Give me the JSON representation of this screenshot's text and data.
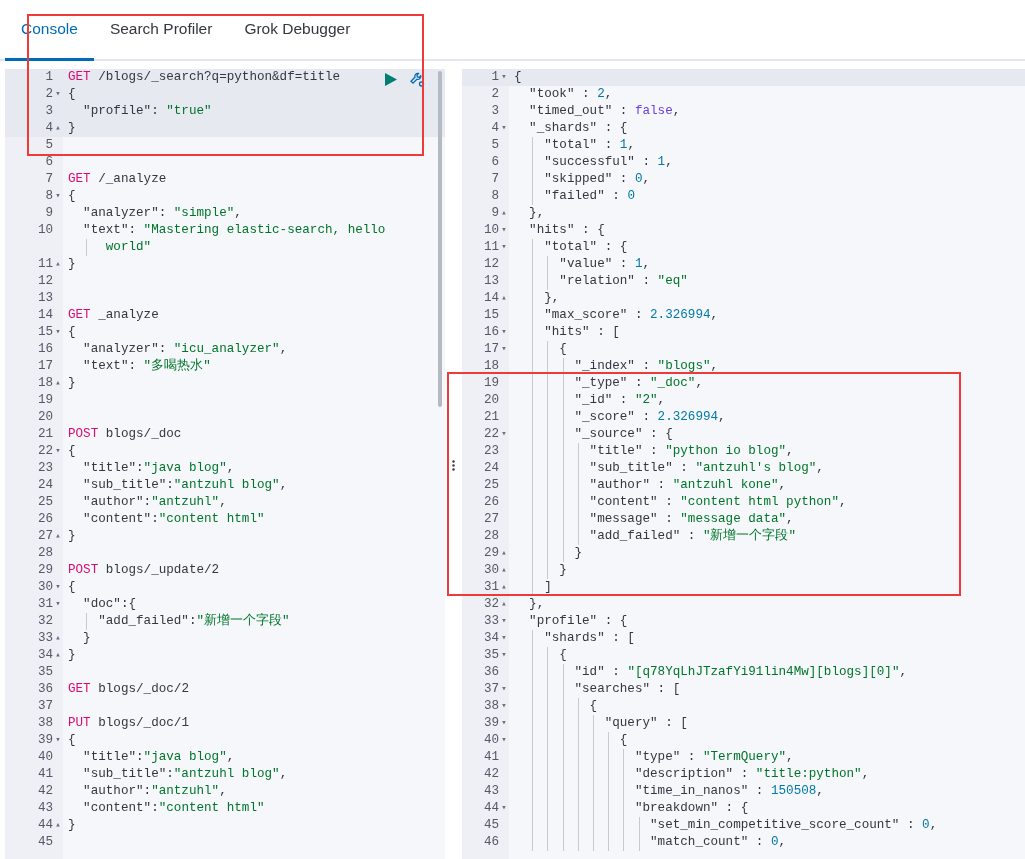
{
  "tabs": [
    {
      "label": "Console",
      "selected": true
    },
    {
      "label": "Search Profiler",
      "selected": false
    },
    {
      "label": "Grok Debugger",
      "selected": false
    }
  ],
  "request_editor": {
    "lines": [
      {
        "n": "1",
        "selected": true,
        "tokens": [
          {
            "kind": "method",
            "text": "GET"
          },
          {
            "kind": "plain",
            "text": " /blogs/_search?q=python&df=title"
          }
        ]
      },
      {
        "n": "2",
        "fold_toggle": "▾",
        "selected": true,
        "tokens": [
          {
            "kind": "plain",
            "text": "{"
          }
        ]
      },
      {
        "n": "3",
        "selected": true,
        "tokens": [
          {
            "kind": "plain",
            "text": "  \"profile\": "
          },
          {
            "kind": "string",
            "text": "\"true\""
          }
        ]
      },
      {
        "n": "4",
        "fold_toggle": "▴",
        "selected": true,
        "tokens": [
          {
            "kind": "plain",
            "text": "}"
          }
        ]
      },
      {
        "n": "5",
        "selected": false
      },
      {
        "n": "6",
        "selected": false
      },
      {
        "n": "7",
        "selected": false,
        "tokens": [
          {
            "kind": "method",
            "text": "GET"
          },
          {
            "kind": "plain",
            "text": " /_analyze"
          }
        ]
      },
      {
        "n": "8",
        "fold_toggle": "▾",
        "selected": false,
        "tokens": [
          {
            "kind": "plain",
            "text": "{"
          }
        ]
      },
      {
        "n": "9",
        "selected": false,
        "tokens": [
          {
            "kind": "plain",
            "text": "  \"analyzer\": "
          },
          {
            "kind": "string",
            "text": "\"simple\""
          },
          {
            "kind": "plain",
            "text": ","
          }
        ]
      },
      {
        "n": "10",
        "selected": false,
        "tokens": [
          {
            "kind": "plain",
            "text": "  \"text\": "
          },
          {
            "kind": "string",
            "text": "\"Mastering elastic-search, hello"
          }
        ]
      },
      {
        "selected": false,
        "tokens": [
          {
            "kind": "string",
            "text": "     world\""
          }
        ]
      },
      {
        "n": "11",
        "fold_toggle": "▴",
        "selected": false,
        "tokens": [
          {
            "kind": "plain",
            "text": "}"
          }
        ]
      },
      {
        "n": "12",
        "selected": false
      },
      {
        "n": "13",
        "selected": false
      },
      {
        "n": "14",
        "selected": false,
        "tokens": [
          {
            "kind": "method",
            "text": "GET"
          },
          {
            "kind": "plain",
            "text": " _analyze"
          }
        ]
      },
      {
        "n": "15",
        "fold_toggle": "▾",
        "selected": false,
        "tokens": [
          {
            "kind": "plain",
            "text": "{"
          }
        ]
      },
      {
        "n": "16",
        "selected": false,
        "tokens": [
          {
            "kind": "plain",
            "text": "  \"analyzer\": "
          },
          {
            "kind": "string",
            "text": "\"icu_analyzer\""
          },
          {
            "kind": "plain",
            "text": ","
          }
        ]
      },
      {
        "n": "17",
        "selected": false,
        "tokens": [
          {
            "kind": "plain",
            "text": "  \"text\": "
          },
          {
            "kind": "string",
            "text": "\"多喝热水\""
          }
        ]
      },
      {
        "n": "18",
        "fold_toggle": "▴",
        "selected": false,
        "tokens": [
          {
            "kind": "plain",
            "text": "}"
          }
        ]
      },
      {
        "n": "19",
        "selected": false
      },
      {
        "n": "20",
        "selected": false
      },
      {
        "n": "21",
        "selected": false,
        "tokens": [
          {
            "kind": "method",
            "text": "POST"
          },
          {
            "kind": "plain",
            "text": " blogs/_doc"
          }
        ]
      },
      {
        "n": "22",
        "fold_toggle": "▾",
        "selected": false,
        "tokens": [
          {
            "kind": "plain",
            "text": "{"
          }
        ]
      },
      {
        "n": "23",
        "selected": false,
        "tokens": [
          {
            "kind": "plain",
            "text": "  \"title\":"
          },
          {
            "kind": "string",
            "text": "\"java blog\""
          },
          {
            "kind": "plain",
            "text": ","
          }
        ]
      },
      {
        "n": "24",
        "selected": false,
        "tokens": [
          {
            "kind": "plain",
            "text": "  \"sub_title\":"
          },
          {
            "kind": "string",
            "text": "\"antzuhl blog\""
          },
          {
            "kind": "plain",
            "text": ","
          }
        ]
      },
      {
        "n": "25",
        "selected": false,
        "tokens": [
          {
            "kind": "plain",
            "text": "  \"author\":"
          },
          {
            "kind": "string",
            "text": "\"antzuhl\""
          },
          {
            "kind": "plain",
            "text": ","
          }
        ]
      },
      {
        "n": "26",
        "selected": false,
        "tokens": [
          {
            "kind": "plain",
            "text": "  \"content\":"
          },
          {
            "kind": "string",
            "text": "\"content html\""
          }
        ]
      },
      {
        "n": "27",
        "fold_toggle": "▴",
        "selected": false,
        "tokens": [
          {
            "kind": "plain",
            "text": "}"
          }
        ]
      },
      {
        "n": "28",
        "selected": false
      },
      {
        "n": "29",
        "selected": false,
        "tokens": [
          {
            "kind": "method",
            "text": "POST"
          },
          {
            "kind": "plain",
            "text": " blogs/_update/2"
          }
        ]
      },
      {
        "n": "30",
        "fold_toggle": "▾",
        "selected": false,
        "tokens": [
          {
            "kind": "plain",
            "text": "{"
          }
        ]
      },
      {
        "n": "31",
        "fold_toggle": "▾",
        "selected": false,
        "tokens": [
          {
            "kind": "plain",
            "text": "  \"doc\":{"
          }
        ]
      },
      {
        "n": "32",
        "selected": false,
        "tokens": [
          {
            "kind": "plain",
            "text": "    \"add_failed\":"
          },
          {
            "kind": "string",
            "text": "\"新增一个字段\""
          }
        ]
      },
      {
        "n": "33",
        "fold_toggle": "▴",
        "selected": false,
        "tokens": [
          {
            "kind": "plain",
            "text": "  }"
          }
        ]
      },
      {
        "n": "34",
        "fold_toggle": "▴",
        "selected": false,
        "tokens": [
          {
            "kind": "plain",
            "text": "}"
          }
        ]
      },
      {
        "n": "35",
        "selected": false
      },
      {
        "n": "36",
        "selected": false,
        "tokens": [
          {
            "kind": "method",
            "text": "GET"
          },
          {
            "kind": "plain",
            "text": " blogs/_doc/2"
          }
        ]
      },
      {
        "n": "37",
        "selected": false
      },
      {
        "n": "38",
        "selected": false,
        "tokens": [
          {
            "kind": "method",
            "text": "PUT"
          },
          {
            "kind": "plain",
            "text": " blogs/_doc/1"
          }
        ]
      },
      {
        "n": "39",
        "fold_toggle": "▾",
        "selected": false,
        "tokens": [
          {
            "kind": "plain",
            "text": "{"
          }
        ]
      },
      {
        "n": "40",
        "selected": false,
        "tokens": [
          {
            "kind": "plain",
            "text": "  \"title\":"
          },
          {
            "kind": "string",
            "text": "\"java blog\""
          },
          {
            "kind": "plain",
            "text": ","
          }
        ]
      },
      {
        "n": "41",
        "selected": false,
        "tokens": [
          {
            "kind": "plain",
            "text": "  \"sub_title\":"
          },
          {
            "kind": "string",
            "text": "\"antzuhl blog\""
          },
          {
            "kind": "plain",
            "text": ","
          }
        ]
      },
      {
        "n": "42",
        "selected": false,
        "tokens": [
          {
            "kind": "plain",
            "text": "  \"author\":"
          },
          {
            "kind": "string",
            "text": "\"antzuhl\""
          },
          {
            "kind": "plain",
            "text": ","
          }
        ]
      },
      {
        "n": "43",
        "selected": false,
        "tokens": [
          {
            "kind": "plain",
            "text": "  \"content\":"
          },
          {
            "kind": "string",
            "text": "\"content html\""
          }
        ]
      },
      {
        "n": "44",
        "fold_toggle": "▴",
        "selected": false,
        "tokens": [
          {
            "kind": "plain",
            "text": "}"
          }
        ]
      },
      {
        "n": "45",
        "selected": false
      }
    ]
  },
  "response_viewer": {
    "lines": [
      {
        "n": "1",
        "fold_toggle": "▾",
        "selected": true,
        "tokens": [
          {
            "kind": "plain",
            "text": "{"
          }
        ]
      },
      {
        "n": "2",
        "selected": false,
        "tokens": [
          {
            "kind": "plain",
            "text": "  \"took\" : "
          },
          {
            "kind": "number",
            "text": "2"
          },
          {
            "kind": "plain",
            "text": ","
          }
        ]
      },
      {
        "n": "3",
        "selected": false,
        "tokens": [
          {
            "kind": "plain",
            "text": "  \"timed_out\" : "
          },
          {
            "kind": "boolean",
            "text": "false"
          },
          {
            "kind": "plain",
            "text": ","
          }
        ]
      },
      {
        "n": "4",
        "fold_toggle": "▾",
        "selected": false,
        "tokens": [
          {
            "kind": "plain",
            "text": "  \"_shards\" : {"
          }
        ]
      },
      {
        "n": "5",
        "selected": false,
        "tokens": [
          {
            "kind": "plain",
            "text": "    \"total\" : "
          },
          {
            "kind": "number",
            "text": "1"
          },
          {
            "kind": "plain",
            "text": ","
          }
        ]
      },
      {
        "n": "6",
        "selected": false,
        "tokens": [
          {
            "kind": "plain",
            "text": "    \"successful\" : "
          },
          {
            "kind": "number",
            "text": "1"
          },
          {
            "kind": "plain",
            "text": ","
          }
        ]
      },
      {
        "n": "7",
        "selected": false,
        "tokens": [
          {
            "kind": "plain",
            "text": "    \"skipped\" : "
          },
          {
            "kind": "number",
            "text": "0"
          },
          {
            "kind": "plain",
            "text": ","
          }
        ]
      },
      {
        "n": "8",
        "selected": false,
        "tokens": [
          {
            "kind": "plain",
            "text": "    \"failed\" : "
          },
          {
            "kind": "number",
            "text": "0"
          }
        ]
      },
      {
        "n": "9",
        "fold_toggle": "▴",
        "selected": false,
        "tokens": [
          {
            "kind": "plain",
            "text": "  },"
          }
        ]
      },
      {
        "n": "10",
        "fold_toggle": "▾",
        "selected": false,
        "tokens": [
          {
            "kind": "plain",
            "text": "  \"hits\" : {"
          }
        ]
      },
      {
        "n": "11",
        "fold_toggle": "▾",
        "selected": false,
        "tokens": [
          {
            "kind": "plain",
            "text": "    \"total\" : {"
          }
        ]
      },
      {
        "n": "12",
        "selected": false,
        "tokens": [
          {
            "kind": "plain",
            "text": "      \"value\" : "
          },
          {
            "kind": "number",
            "text": "1"
          },
          {
            "kind": "plain",
            "text": ","
          }
        ]
      },
      {
        "n": "13",
        "selected": false,
        "tokens": [
          {
            "kind": "plain",
            "text": "      \"relation\" : "
          },
          {
            "kind": "string",
            "text": "\"eq\""
          }
        ]
      },
      {
        "n": "14",
        "fold_toggle": "▴",
        "selected": false,
        "tokens": [
          {
            "kind": "plain",
            "text": "    },"
          }
        ]
      },
      {
        "n": "15",
        "selected": false,
        "tokens": [
          {
            "kind": "plain",
            "text": "    \"max_score\" : "
          },
          {
            "kind": "number",
            "text": "2.326994"
          },
          {
            "kind": "plain",
            "text": ","
          }
        ]
      },
      {
        "n": "16",
        "fold_toggle": "▾",
        "selected": false,
        "tokens": [
          {
            "kind": "plain",
            "text": "    \"hits\" : ["
          }
        ]
      },
      {
        "n": "17",
        "fold_toggle": "▾",
        "selected": false,
        "tokens": [
          {
            "kind": "plain",
            "text": "      {"
          }
        ]
      },
      {
        "n": "18",
        "selected": false,
        "tokens": [
          {
            "kind": "plain",
            "text": "        \"_index\" : "
          },
          {
            "kind": "string",
            "text": "\"blogs\""
          },
          {
            "kind": "plain",
            "text": ","
          }
        ]
      },
      {
        "n": "19",
        "selected": false,
        "tokens": [
          {
            "kind": "plain",
            "text": "        \"_type\" : "
          },
          {
            "kind": "string",
            "text": "\"_doc\""
          },
          {
            "kind": "plain",
            "text": ","
          }
        ]
      },
      {
        "n": "20",
        "selected": false,
        "tokens": [
          {
            "kind": "plain",
            "text": "        \"_id\" : "
          },
          {
            "kind": "string",
            "text": "\"2\""
          },
          {
            "kind": "plain",
            "text": ","
          }
        ]
      },
      {
        "n": "21",
        "selected": false,
        "tokens": [
          {
            "kind": "plain",
            "text": "        \"_score\" : "
          },
          {
            "kind": "number",
            "text": "2.326994"
          },
          {
            "kind": "plain",
            "text": ","
          }
        ]
      },
      {
        "n": "22",
        "fold_toggle": "▾",
        "selected": false,
        "tokens": [
          {
            "kind": "plain",
            "text": "        \"_source\" : {"
          }
        ]
      },
      {
        "n": "23",
        "selected": false,
        "tokens": [
          {
            "kind": "plain",
            "text": "          \"title\" : "
          },
          {
            "kind": "string",
            "text": "\"python io blog\""
          },
          {
            "kind": "plain",
            "text": ","
          }
        ]
      },
      {
        "n": "24",
        "selected": false,
        "tokens": [
          {
            "kind": "plain",
            "text": "          \"sub_title\" : "
          },
          {
            "kind": "string",
            "text": "\"antzuhl's blog\""
          },
          {
            "kind": "plain",
            "text": ","
          }
        ]
      },
      {
        "n": "25",
        "selected": false,
        "tokens": [
          {
            "kind": "plain",
            "text": "          \"author\" : "
          },
          {
            "kind": "string",
            "text": "\"antzuhl kone\""
          },
          {
            "kind": "plain",
            "text": ","
          }
        ]
      },
      {
        "n": "26",
        "selected": false,
        "tokens": [
          {
            "kind": "plain",
            "text": "          \"content\" : "
          },
          {
            "kind": "string",
            "text": "\"content html python\""
          },
          {
            "kind": "plain",
            "text": ","
          }
        ]
      },
      {
        "n": "27",
        "selected": false,
        "tokens": [
          {
            "kind": "plain",
            "text": "          \"message\" : "
          },
          {
            "kind": "string",
            "text": "\"message data\""
          },
          {
            "kind": "plain",
            "text": ","
          }
        ]
      },
      {
        "n": "28",
        "selected": false,
        "tokens": [
          {
            "kind": "plain",
            "text": "          \"add_failed\" : "
          },
          {
            "kind": "string",
            "text": "\"新增一个字段\""
          }
        ]
      },
      {
        "n": "29",
        "fold_toggle": "▴",
        "selected": false,
        "tokens": [
          {
            "kind": "plain",
            "text": "        }"
          }
        ]
      },
      {
        "n": "30",
        "fold_toggle": "▴",
        "selected": false,
        "tokens": [
          {
            "kind": "plain",
            "text": "      }"
          }
        ]
      },
      {
        "n": "31",
        "fold_toggle": "▴",
        "selected": false,
        "tokens": [
          {
            "kind": "plain",
            "text": "    ]"
          }
        ]
      },
      {
        "n": "32",
        "fold_toggle": "▴",
        "selected": false,
        "tokens": [
          {
            "kind": "plain",
            "text": "  },"
          }
        ]
      },
      {
        "n": "33",
        "fold_toggle": "▾",
        "selected": false,
        "tokens": [
          {
            "kind": "plain",
            "text": "  \"profile\" : {"
          }
        ]
      },
      {
        "n": "34",
        "fold_toggle": "▾",
        "selected": false,
        "tokens": [
          {
            "kind": "plain",
            "text": "    \"shards\" : ["
          }
        ]
      },
      {
        "n": "35",
        "fold_toggle": "▾",
        "selected": false,
        "tokens": [
          {
            "kind": "plain",
            "text": "      {"
          }
        ]
      },
      {
        "n": "36",
        "selected": false,
        "tokens": [
          {
            "kind": "plain",
            "text": "        \"id\" : "
          },
          {
            "kind": "string",
            "text": "\"[q78YqLhJTzafYi91lin4Mw][blogs][0]\""
          },
          {
            "kind": "plain",
            "text": ","
          }
        ]
      },
      {
        "n": "37",
        "fold_toggle": "▾",
        "selected": false,
        "tokens": [
          {
            "kind": "plain",
            "text": "        \"searches\" : ["
          }
        ]
      },
      {
        "n": "38",
        "fold_toggle": "▾",
        "selected": false,
        "tokens": [
          {
            "kind": "plain",
            "text": "          {"
          }
        ]
      },
      {
        "n": "39",
        "fold_toggle": "▾",
        "selected": false,
        "tokens": [
          {
            "kind": "plain",
            "text": "            \"query\" : ["
          }
        ]
      },
      {
        "n": "40",
        "fold_toggle": "▾",
        "selected": false,
        "tokens": [
          {
            "kind": "plain",
            "text": "              {"
          }
        ]
      },
      {
        "n": "41",
        "selected": false,
        "tokens": [
          {
            "kind": "plain",
            "text": "                \"type\" : "
          },
          {
            "kind": "string",
            "text": "\"TermQuery\""
          },
          {
            "kind": "plain",
            "text": ","
          }
        ]
      },
      {
        "n": "42",
        "selected": false,
        "tokens": [
          {
            "kind": "plain",
            "text": "                \"description\" : "
          },
          {
            "kind": "string",
            "text": "\"title:python\""
          },
          {
            "kind": "plain",
            "text": ","
          }
        ]
      },
      {
        "n": "43",
        "selected": false,
        "tokens": [
          {
            "kind": "plain",
            "text": "                \"time_in_nanos\" : "
          },
          {
            "kind": "number",
            "text": "150508"
          },
          {
            "kind": "plain",
            "text": ","
          }
        ]
      },
      {
        "n": "44",
        "fold_toggle": "▾",
        "selected": false,
        "tokens": [
          {
            "kind": "plain",
            "text": "                \"breakdown\" : {"
          }
        ]
      },
      {
        "n": "45",
        "selected": false,
        "tokens": [
          {
            "kind": "plain",
            "text": "                  \"set_min_competitive_score_count\" : "
          },
          {
            "kind": "number",
            "text": "0"
          },
          {
            "kind": "plain",
            "text": ","
          }
        ]
      },
      {
        "n": "46",
        "selected": false,
        "tokens": [
          {
            "kind": "plain",
            "text": "                  \"match_count\" : "
          },
          {
            "kind": "number",
            "text": "0"
          },
          {
            "kind": "plain",
            "text": ","
          }
        ]
      }
    ]
  }
}
